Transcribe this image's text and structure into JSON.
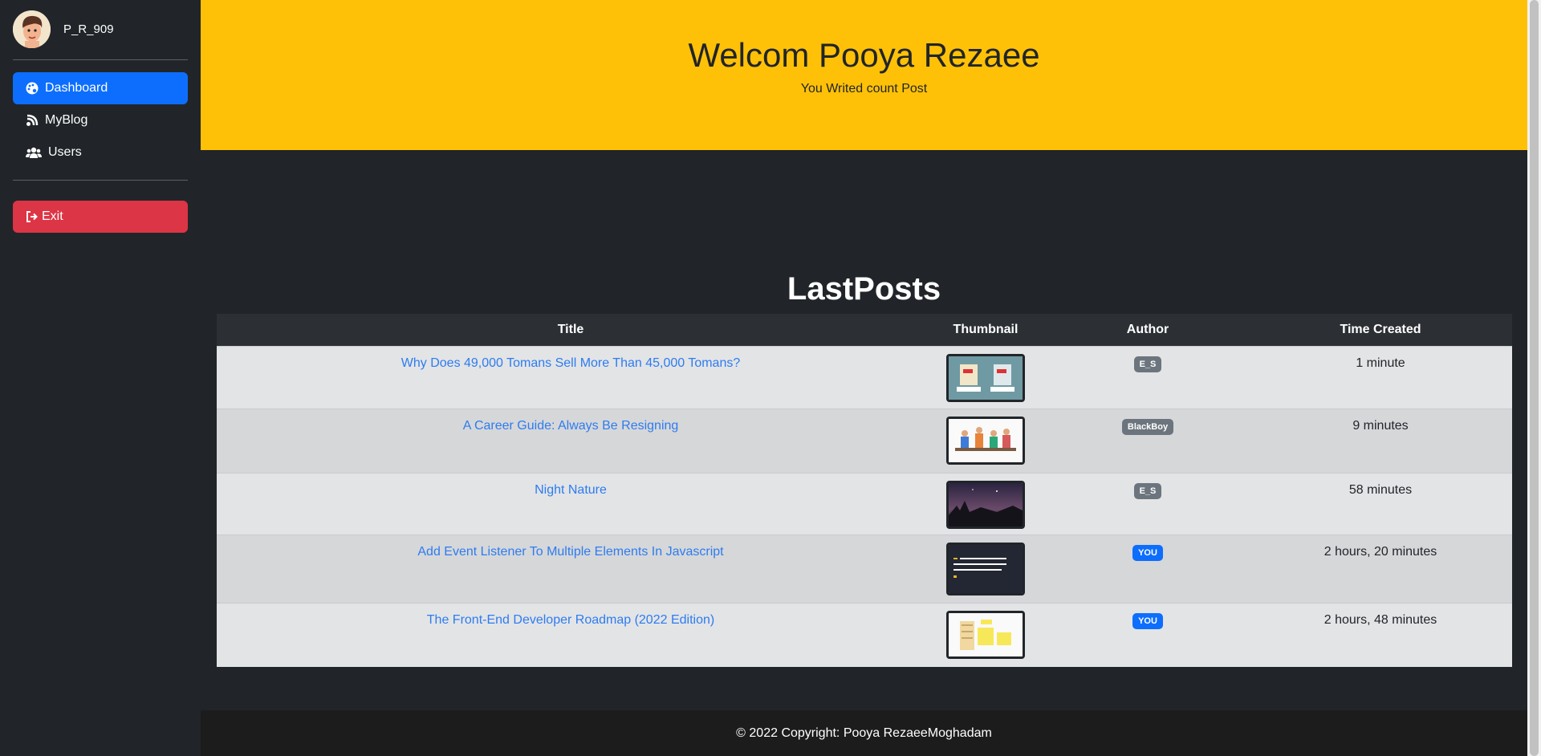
{
  "sidebar": {
    "username": "P_R_909",
    "nav": [
      {
        "label": "Dashboard",
        "icon": "palette-icon",
        "active": true
      },
      {
        "label": "MyBlog",
        "icon": "blog-icon",
        "active": false
      },
      {
        "label": "Users",
        "icon": "users-icon",
        "active": false
      }
    ],
    "exit_label": "Exit"
  },
  "hero": {
    "title": "Welcom Pooya Rezaee",
    "subtitle": "You Writed count Post"
  },
  "posts": {
    "section_title": "LastPosts",
    "headers": {
      "title": "Title",
      "thumbnail": "Thumbnail",
      "author": "Author",
      "time": "Time Created"
    },
    "rows": [
      {
        "title": "Why Does 49,000 Tomans Sell More Than 45,000 Tomans?",
        "author": "E_S",
        "author_color": "#6c757d",
        "time": "1 minute"
      },
      {
        "title": "A Career Guide: Always Be Resigning",
        "author": "BlackBoy",
        "author_color": "#6c757d",
        "time": "9 minutes"
      },
      {
        "title": "Night Nature",
        "author": "E_S",
        "author_color": "#6c757d",
        "time": "58 minutes"
      },
      {
        "title": "Add Event Listener To Multiple Elements In Javascript",
        "author": "YOU",
        "author_color": "#0d6efd",
        "time": "2 hours, 20 minutes"
      },
      {
        "title": "The Front-End Developer Roadmap (2022 Edition)",
        "author": "YOU",
        "author_color": "#0d6efd",
        "time": "2 hours, 48 minutes"
      }
    ]
  },
  "footer": {
    "text": "© 2022 Copyright: Pooya RezaeeMoghadam"
  },
  "colors": {
    "accent": "#0d6efd",
    "hero": "#ffc107",
    "danger": "#dc3545"
  }
}
